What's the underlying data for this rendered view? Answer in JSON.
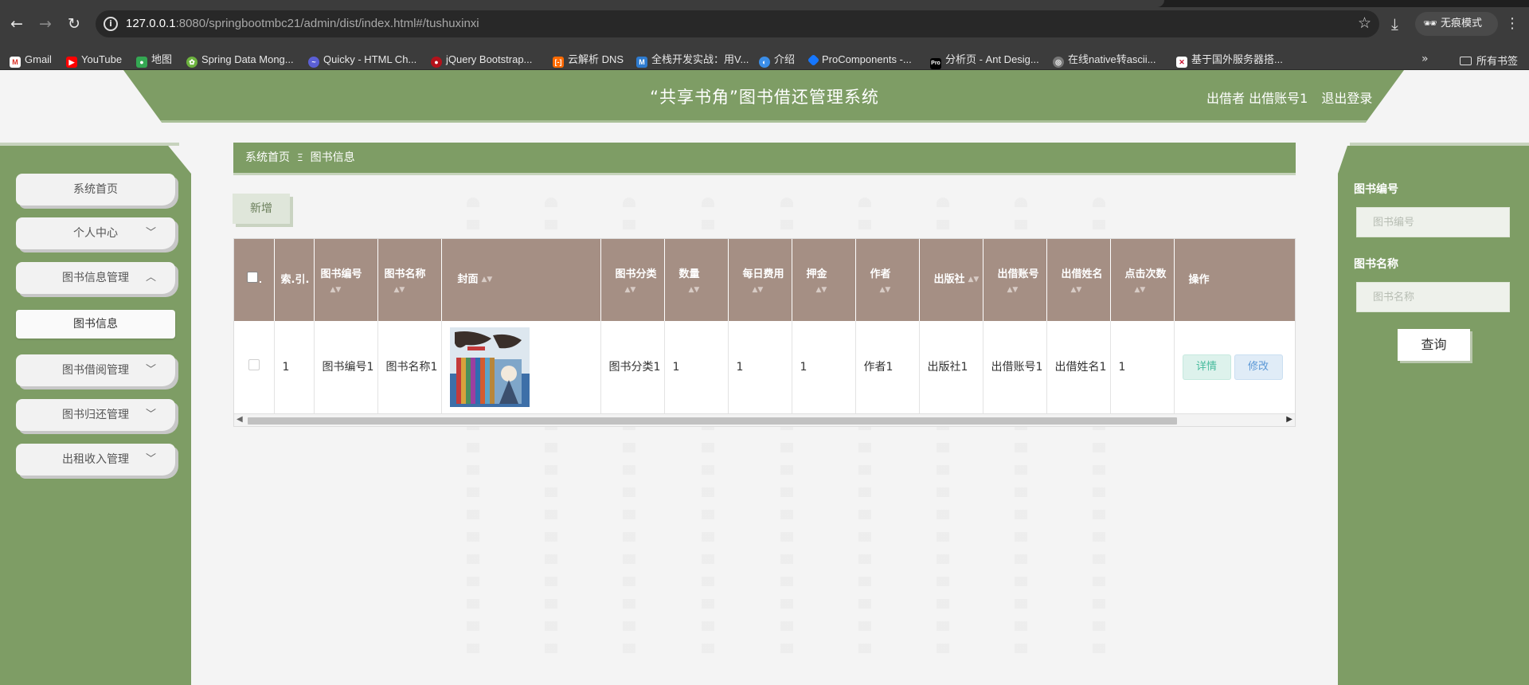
{
  "browser": {
    "url_host": "127.0.0.1",
    "url_rest": ":8080/springbootmbc21/admin/dist/index.html#/tushuxinxi",
    "incognito_label": "无痕模式",
    "bookmarks": [
      "Gmail",
      "YouTube",
      "地图",
      "Spring Data Mong...",
      "Quicky - HTML Ch...",
      "jQuery Bootstrap...",
      "云解析 DNS",
      "全栈开发实战：用V...",
      "介绍",
      "ProComponents -...",
      "分析页 - Ant Desig...",
      "在线native转ascii...",
      "基于国外服务器搭..."
    ],
    "all_bookmarks_label": "所有书签"
  },
  "header": {
    "title": "“共享书角”图书借还管理系统",
    "user_role": "出借者",
    "user_name": "出借账号1",
    "logout": "退出登录"
  },
  "sidebar": {
    "items": [
      {
        "label": "系统首页"
      },
      {
        "label": "个人中心"
      },
      {
        "label": "图书信息管理"
      },
      {
        "label": "图书信息"
      },
      {
        "label": "图书借阅管理"
      },
      {
        "label": "图书归还管理"
      },
      {
        "label": "出租收入管理"
      }
    ]
  },
  "breadcrumb": {
    "home": "系统首页",
    "current": "图书信息"
  },
  "toolbar": {
    "add_label": "新增"
  },
  "table": {
    "headers": [
      "索.引.",
      "图书编号",
      "图书名称",
      "封面",
      "图书分类",
      "数量",
      "每日费用",
      "押金",
      "作者",
      "出版社",
      "出借账号",
      "出借姓名",
      "点击次数",
      "操作"
    ],
    "rows": [
      {
        "index": "1",
        "code": "图书编号1",
        "name": "图书名称1",
        "category": "图书分类1",
        "quantity": "1",
        "daily_fee": "1",
        "deposit": "1",
        "author": "作者1",
        "publisher": "出版社1",
        "lender_account": "出借账号1",
        "lender_name": "出借姓名1",
        "clicks": "1",
        "detail_label": "详情",
        "edit_label": "修改"
      }
    ]
  },
  "search": {
    "code_label": "图书编号",
    "code_placeholder": "图书编号",
    "name_label": "图书名称",
    "name_placeholder": "图书名称",
    "button_label": "查询"
  },
  "colors": {
    "theme_green": "#7e9d65",
    "table_header": "#a58f84",
    "detail_btn": "#47bb9d",
    "edit_btn": "#5b98d6"
  }
}
